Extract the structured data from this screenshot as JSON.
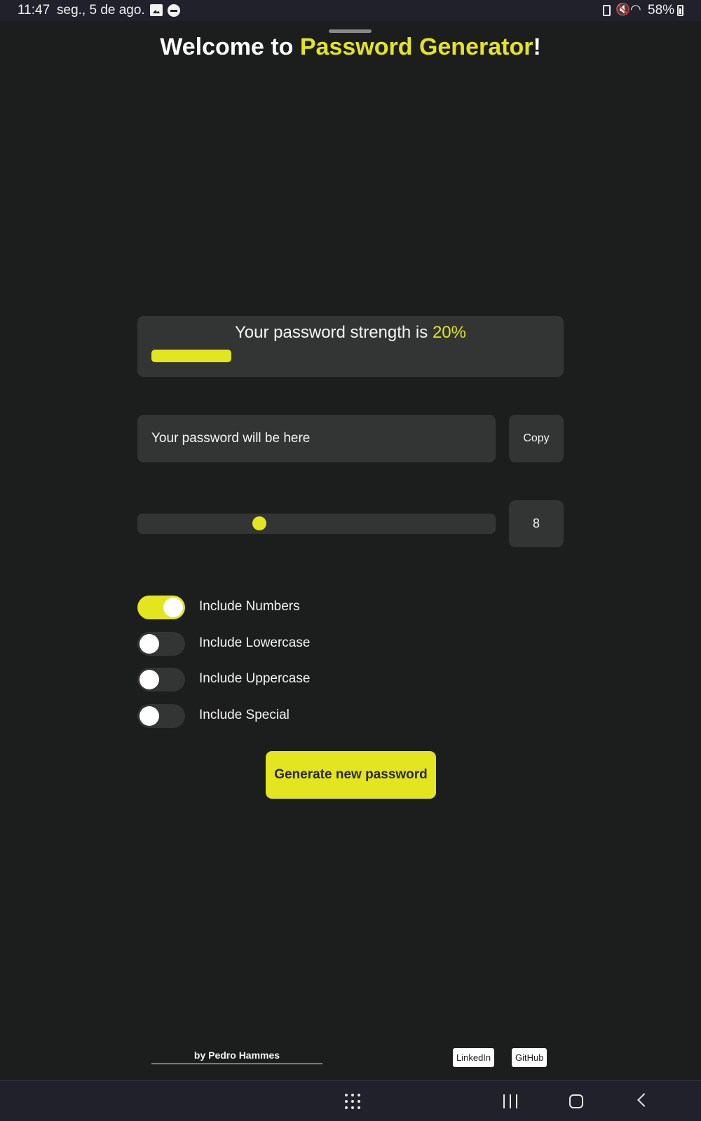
{
  "status_bar": {
    "time": "11:47",
    "date": "seg., 5 de ago.",
    "battery": "58%",
    "icons": [
      "image-icon",
      "dnd-icon",
      "battery-saver-icon",
      "mute-icon",
      "wifi-icon",
      "battery-icon"
    ]
  },
  "header": {
    "title_prefix": "Welcome to ",
    "title_highlight": "Password Generator",
    "title_suffix": "!"
  },
  "strength": {
    "label": "Your password strength is ",
    "value": "20%",
    "fraction": 0.2
  },
  "password": {
    "placeholder": "Your password will be here",
    "copy_label": "Copy"
  },
  "length": {
    "value": "8",
    "slider_fraction": 0.34
  },
  "options": [
    {
      "label": "Include Numbers",
      "enabled": true
    },
    {
      "label": "Include Lowercase",
      "enabled": false
    },
    {
      "label": "Include Uppercase",
      "enabled": false
    },
    {
      "label": "Include Special",
      "enabled": false
    }
  ],
  "generate_label": "Generate new password",
  "footer": {
    "author": "by Pedro Hammes",
    "linkedin": "LinkedIn",
    "github": "GitHub"
  },
  "colors": {
    "accent": "#e3e51e",
    "background": "#1c1d1d",
    "card": "#333434"
  },
  "nav_icons": [
    "apps-icon",
    "recents-icon",
    "home-icon",
    "back-icon"
  ]
}
